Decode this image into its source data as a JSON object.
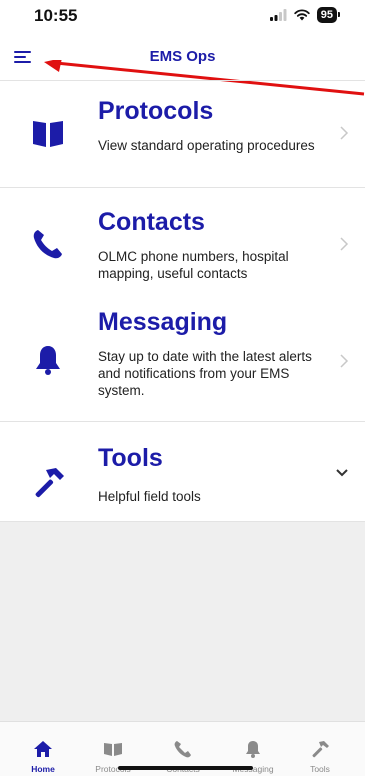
{
  "status": {
    "time": "10:55",
    "battery": "95"
  },
  "header": {
    "title": "EMS Ops",
    "menu_icon": "hamburger-menu-icon"
  },
  "colors": {
    "accent": "#1c1ca8",
    "annotation": "#e01010",
    "background": "#ffffff",
    "empty_area": "#efefef"
  },
  "items": [
    {
      "title": "Protocols",
      "description": "View standard operating procedures",
      "icon": "book-icon",
      "trailing": "chevron-right"
    },
    {
      "title": "Contacts",
      "description": "OLMC phone numbers, hospital mapping, useful contacts",
      "icon": "phone-icon",
      "trailing": "chevron-right"
    },
    {
      "title": "Messaging",
      "description": "Stay up to date with the latest alerts and notifications from your EMS system.",
      "icon": "bell-icon",
      "trailing": "chevron-right"
    },
    {
      "title": "Tools",
      "description": "Helpful field tools",
      "icon": "hammer-icon",
      "trailing": "chevron-down"
    }
  ],
  "tabs": [
    {
      "label": "Home",
      "icon": "home-icon",
      "active": true
    },
    {
      "label": "Protocols",
      "icon": "book-icon",
      "active": false
    },
    {
      "label": "Contacts",
      "icon": "phone-icon",
      "active": false
    },
    {
      "label": "Messaging",
      "icon": "bell-icon",
      "active": false
    },
    {
      "label": "Tools",
      "icon": "hammer-icon",
      "active": false
    }
  ]
}
